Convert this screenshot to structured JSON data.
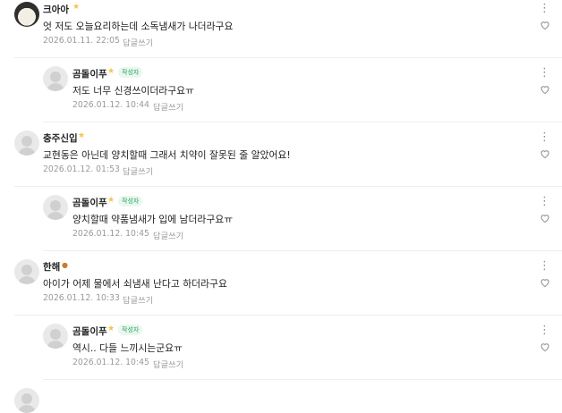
{
  "comments": [
    {
      "nick": "크아아",
      "text": "엇 저도 오늘요리하는데 소독냄새가 나더라구요",
      "date": "2026.01.11. 22:05",
      "reply_label": "답글쓰기"
    },
    {
      "nick": "곰돌이푸",
      "badge": "작성자",
      "text": "저도 너무 신경쓰이더라구요ㅠ",
      "date": "2026.01.12. 10:44",
      "reply_label": "답글쓰기"
    },
    {
      "nick": "충주신입",
      "text": "교현동은 아닌데 양치할때 그래서 치약이 잘못된 줄 알았어요!",
      "date": "2026.01.12. 01:53",
      "reply_label": "답글쓰기"
    },
    {
      "nick": "곰돌이푸",
      "badge": "작성자",
      "text": "양치할때 약품냄새가 입에 남더라구요ㅠ",
      "date": "2026.01.12. 10:45",
      "reply_label": "답글쓰기"
    },
    {
      "nick": "한해",
      "text": "아이가 어제 물에서 쇠냄새 난다고 하더라구요",
      "date": "2026.01.12. 10:33",
      "reply_label": "답글쓰기"
    },
    {
      "nick": "곰돌이푸",
      "badge": "작성자",
      "text": "역시.. 다들 느끼시는군요ㅠ",
      "date": "2026.01.12. 10:45",
      "reply_label": "답글쓰기"
    }
  ],
  "icons": {
    "more": "more-icon",
    "like": "heart-icon",
    "grade": "star-icon"
  },
  "colors": {
    "star": "#f3c64a",
    "author_badge": "#27a35e"
  }
}
